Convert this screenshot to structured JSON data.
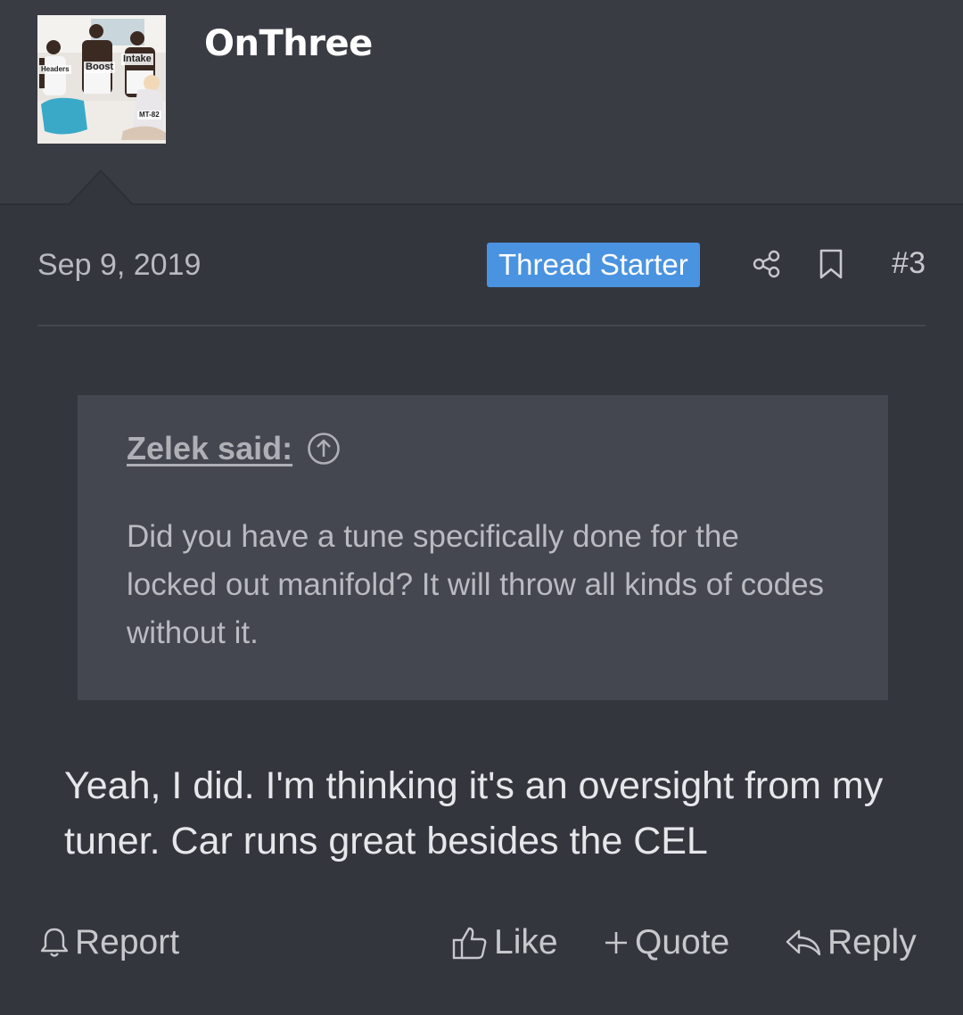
{
  "author": {
    "name": "OnThree",
    "avatar_tags": [
      "Headers",
      "Boost",
      "Intake",
      "MT-82"
    ]
  },
  "post": {
    "date": "Sep 9, 2019",
    "badge": "Thread Starter",
    "number": "#3",
    "message": "Yeah, I did. I'm thinking it's an oversight from my tuner. Car runs great besides the CEL"
  },
  "quote": {
    "author_label": "Zelek said:",
    "text": "Did you have a tune specifically done for the locked out manifold? It will throw all kinds of codes without it."
  },
  "actions": {
    "report": "Report",
    "like": "Like",
    "quote": "Quote",
    "reply": "Reply"
  },
  "icons": {
    "share": "share-icon",
    "bookmark": "bookmark-icon",
    "jump": "arrow-up-circle-icon",
    "report": "bell-icon",
    "like": "thumbs-up-icon",
    "quote": "plus-icon",
    "reply": "reply-icon"
  },
  "colors": {
    "background": "#34363e",
    "header": "#3a3c44",
    "quote_background": "#444650",
    "badge": "#4a93e0"
  }
}
